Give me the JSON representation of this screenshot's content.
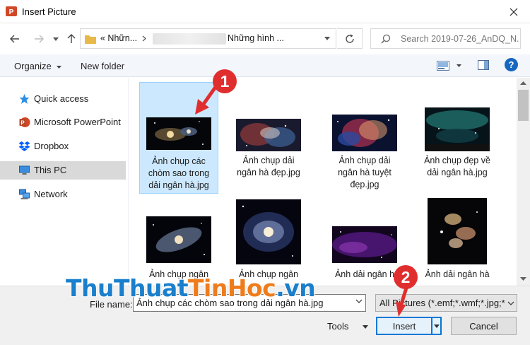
{
  "window": {
    "title": "Insert Picture"
  },
  "address": {
    "crumb_first": "« Nhữn...",
    "crumb_last": "Những hình ...",
    "search_placeholder": "Search 2019-07-26_AnDQ_N..."
  },
  "toolbar": {
    "organize": "Organize",
    "new_folder": "New folder"
  },
  "sidebar": {
    "items": [
      {
        "label": "Quick access"
      },
      {
        "label": "Microsoft PowerPoint"
      },
      {
        "label": "Dropbox"
      },
      {
        "label": "This PC"
      },
      {
        "label": "Network"
      }
    ]
  },
  "files": [
    {
      "l1": "Ảnh chụp các",
      "l2": "chòm sao trong",
      "l3": "dải ngân hà.jpg"
    },
    {
      "l1": "Ảnh chụp dải",
      "l2": "ngân hà đẹp.jpg",
      "l3": ""
    },
    {
      "l1": "Ảnh chụp dải",
      "l2": "ngân hà tuyệt",
      "l3": "đẹp.jpg"
    },
    {
      "l1": "Ảnh chụp đẹp về",
      "l2": "dải ngân hà.jpg",
      "l3": ""
    },
    {
      "l1": "Ảnh chụp ngân",
      "l2": "",
      "l3": ""
    },
    {
      "l1": "Ảnh chụp ngân",
      "l2": "",
      "l3": ""
    },
    {
      "l1": "Ảnh dải ngân h",
      "l2": "",
      "l3": ""
    },
    {
      "l1": "Ảnh dải ngân hà",
      "l2": "",
      "l3": ""
    }
  ],
  "bottom": {
    "file_name_label": "File name:",
    "file_name_value": "Ảnh chụp các chòm sao trong dải ngân hà.jpg",
    "file_type": "All Pictures (*.emf;*.wmf;*.jpg;*.j",
    "tools_label": "Tools",
    "insert_label": "Insert",
    "cancel_label": "Cancel"
  },
  "annotations": {
    "marker1": "1",
    "marker2": "2"
  },
  "watermark": {
    "part1": "ThuThuat",
    "part2": "TinHoc",
    "part3": ".vn"
  },
  "colors": {
    "accent": "#0078d7",
    "marker": "#e02e2e",
    "selection": "#cce8ff"
  }
}
